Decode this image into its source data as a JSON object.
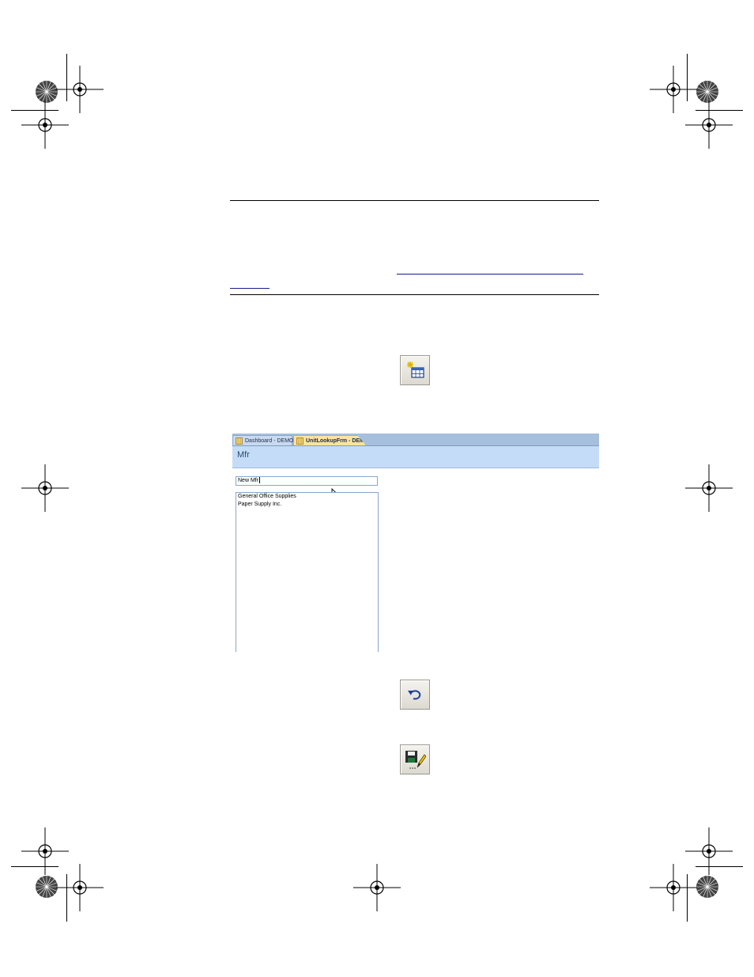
{
  "app": {
    "tabs": [
      {
        "label": "Dashboard - DEMO"
      },
      {
        "label": "UnitLookupFrm - DEMO"
      }
    ],
    "form_title": "Mfr",
    "input_value": "New Mfr",
    "list_items": [
      "General Office Supplies",
      "Paper Supply Inc."
    ]
  },
  "icons": {
    "new_record": "new-record-grid-icon",
    "undo": "undo-arrow-icon",
    "save_edit": "save-disk-pencil-icon"
  },
  "colors": {
    "tab_active": "#fce3a0",
    "tab_inactive": "#c9daf0",
    "form_header": "#c4dcf7",
    "form_title": "#2a4c7c"
  }
}
